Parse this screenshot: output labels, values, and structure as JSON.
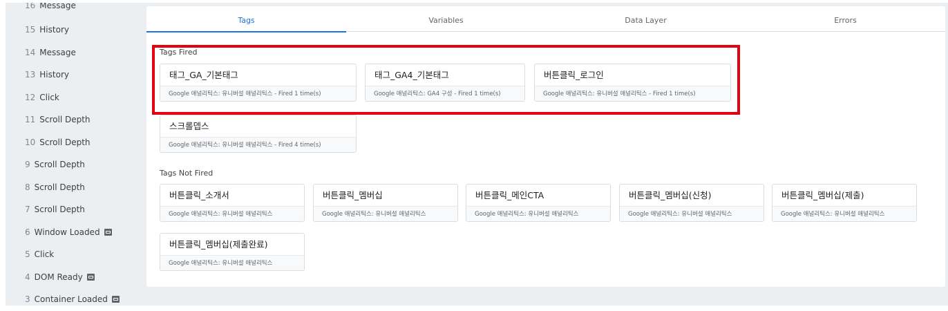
{
  "sidebar": {
    "items": [
      {
        "num": "16",
        "label": "Message",
        "icon": false
      },
      {
        "num": "15",
        "label": "History",
        "icon": false
      },
      {
        "num": "14",
        "label": "Message",
        "icon": false
      },
      {
        "num": "13",
        "label": "History",
        "icon": false
      },
      {
        "num": "12",
        "label": "Click",
        "icon": false
      },
      {
        "num": "11",
        "label": "Scroll Depth",
        "icon": false
      },
      {
        "num": "10",
        "label": "Scroll Depth",
        "icon": false
      },
      {
        "num": "9",
        "label": "Scroll Depth",
        "icon": false
      },
      {
        "num": "8",
        "label": "Scroll Depth",
        "icon": false
      },
      {
        "num": "7",
        "label": "Scroll Depth",
        "icon": false
      },
      {
        "num": "6",
        "label": "Window Loaded",
        "icon": true
      },
      {
        "num": "5",
        "label": "Click",
        "icon": false
      },
      {
        "num": "4",
        "label": "DOM Ready",
        "icon": true
      },
      {
        "num": "3",
        "label": "Container Loaded",
        "icon": true
      }
    ]
  },
  "tabs": [
    {
      "label": "Tags"
    },
    {
      "label": "Variables"
    },
    {
      "label": "Data Layer"
    },
    {
      "label": "Errors"
    }
  ],
  "fired": {
    "title": "Tags Fired",
    "tags": [
      {
        "name": "태그_GA_기본태그",
        "desc": "Google 애널리틱스: 유니버설 애널리틱스 - Fired 1 time(s)"
      },
      {
        "name": "태그_GA4_기본태그",
        "desc": "Google 애널리틱스: GA4 구성 - Fired 1 time(s)"
      },
      {
        "name": "버튼클릭_로그인",
        "desc": "Google 애널리틱스: 유니버설 애널리틱스 - Fired 1 time(s)"
      },
      {
        "name": "스크롤뎁스",
        "desc": "Google 애널리틱스: 유니버설 애널리틱스 - Fired 4 time(s)"
      }
    ]
  },
  "not_fired": {
    "title": "Tags Not Fired",
    "tags": [
      {
        "name": "버튼클릭_소개서",
        "desc": "Google 애널리틱스: 유니버설 애널리틱스"
      },
      {
        "name": "버튼클릭_멤버십",
        "desc": "Google 애널리틱스: 유니버설 애널리틱스"
      },
      {
        "name": "버튼클릭_메인CTA",
        "desc": "Google 애널리틱스: 유니버설 애널리틱스"
      },
      {
        "name": "버튼클릭_멤버십(신청)",
        "desc": "Google 애널리틱스: 유니버설 애널리틱스"
      },
      {
        "name": "버튼클릭_멤버십(제출)",
        "desc": "Google 애널리틱스: 유니버설 애널리틱스"
      },
      {
        "name": "버튼클릭_멤버십(제출완료)",
        "desc": "Google 애널리틱스: 유니버설 애널리틱스"
      }
    ]
  },
  "colors": {
    "accent": "#1a73e8",
    "highlight": "#e3000f"
  }
}
